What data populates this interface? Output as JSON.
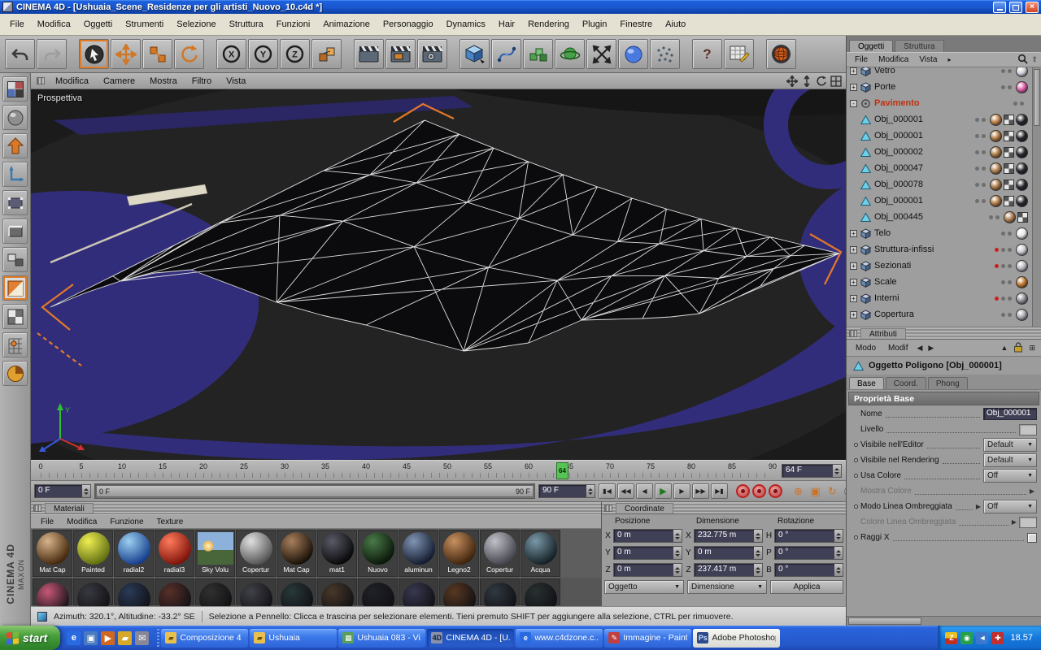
{
  "window": {
    "title": "CINEMA 4D - [Ushuaia_Scene_Residenze per gli artisti_Nuovo_10.c4d *]"
  },
  "menubar": [
    "File",
    "Modifica",
    "Oggetti",
    "Strumenti",
    "Selezione",
    "Struttura",
    "Funzioni",
    "Animazione",
    "Personaggio",
    "Dynamics",
    "Hair",
    "Rendering",
    "Plugin",
    "Finestre",
    "Aiuto"
  ],
  "toolbar": [
    {
      "name": "undo",
      "group": 1
    },
    {
      "name": "redo",
      "group": 1
    },
    {
      "name": "live-selection",
      "group": 2,
      "selected": true
    },
    {
      "name": "move",
      "group": 2
    },
    {
      "name": "scale",
      "group": 2
    },
    {
      "name": "rotate",
      "group": 2
    },
    {
      "name": "lock-x",
      "group": 3
    },
    {
      "name": "lock-y",
      "group": 3
    },
    {
      "name": "lock-z",
      "group": 3
    },
    {
      "name": "coordinate-system",
      "group": 3
    },
    {
      "name": "render-view",
      "group": 4
    },
    {
      "name": "render-active-view",
      "group": 4
    },
    {
      "name": "render-settings",
      "group": 4
    },
    {
      "name": "add-primitive",
      "group": 5
    },
    {
      "name": "add-spline",
      "group": 5
    },
    {
      "name": "add-array",
      "group": 5
    },
    {
      "name": "add-modifier",
      "group": 5
    },
    {
      "name": "add-deformer",
      "group": 5
    },
    {
      "name": "add-environment",
      "group": 5
    },
    {
      "name": "add-particles",
      "group": 5
    },
    {
      "name": "help",
      "group": 6
    },
    {
      "name": "content-browser",
      "group": 6
    },
    {
      "name": "online-updater",
      "group": 7
    }
  ],
  "sidebar": [
    {
      "name": "viewport-layout"
    },
    {
      "name": "model-mode"
    },
    {
      "name": "make-editable"
    },
    {
      "name": "axis-mode"
    },
    {
      "name": "points-mode"
    },
    {
      "name": "edges-mode"
    },
    {
      "name": "polygons-mode"
    },
    {
      "name": "texture-mode",
      "selected": true
    },
    {
      "name": "workplane-mode"
    },
    {
      "name": "snap-mode"
    },
    {
      "name": "render-region"
    }
  ],
  "viewport": {
    "menu": [
      "Modifica",
      "Camere",
      "Mostra",
      "Filtro",
      "Vista"
    ],
    "label": "Prospettiva",
    "nav_icons": [
      "pan-view-icon",
      "dolly-view-icon",
      "rotate-view-icon",
      "toggle-views-icon"
    ]
  },
  "timeline": {
    "tick_labels": [
      "0",
      "5",
      "10",
      "15",
      "20",
      "25",
      "30",
      "35",
      "40",
      "45",
      "50",
      "55",
      "60",
      "65",
      "70",
      "75",
      "80",
      "85",
      "90"
    ],
    "current_marker": "64",
    "current_frame": "64 F",
    "range_start": "0 F",
    "range_min_label": "0 F",
    "range_max_label": "90 F",
    "range_end": "90 F",
    "transport": [
      "goto-start",
      "prev-key",
      "prev-frame",
      "play",
      "next-frame",
      "next-key",
      "goto-end"
    ],
    "records": [
      "record-keyframe-icon",
      "autokey-icon",
      "record-settings-icon"
    ],
    "extras": [
      "record-position-icon",
      "record-scale-icon",
      "record-rotation-icon",
      "record-parameter-icon",
      "keyframe-bar-icon",
      "layout-icon"
    ]
  },
  "materials": {
    "header": "Materiali",
    "menu": [
      "File",
      "Modifica",
      "Funzione",
      "Texture"
    ],
    "items": [
      {
        "label": "Mat Cap",
        "c1": "#d8b48c",
        "c2": "#402408"
      },
      {
        "label": "Painted",
        "c1": "#f0ee52",
        "c2": "#5a6a10"
      },
      {
        "label": "radial2",
        "c1": "#9cd0f0",
        "c2": "#123a8a"
      },
      {
        "label": "radial3",
        "c1": "#ff7a5a",
        "c2": "#7a1008"
      },
      {
        "label": "Sky Volu",
        "type": "sky"
      },
      {
        "label": "Copertur",
        "c1": "#e0e0e0",
        "c2": "#505050"
      },
      {
        "label": "Mat Cap",
        "c1": "#a8805c",
        "c2": "#140c04"
      },
      {
        "label": "mat1",
        "c1": "#5a5a66",
        "c2": "#060608"
      },
      {
        "label": "Nuovo",
        "c1": "#4a7a48",
        "c2": "#081408"
      },
      {
        "label": "aluminun",
        "c1": "#8094b4",
        "c2": "#10182a"
      },
      {
        "label": "Legno2",
        "c1": "#c89060",
        "c2": "#3a200a"
      },
      {
        "label": "Copertur",
        "c1": "#c0c0c8",
        "c2": "#404048"
      },
      {
        "label": "Acqua",
        "c1": "#7a98a8",
        "c2": "#101c20"
      }
    ],
    "partial_row": [
      "#c85878",
      "#383840",
      "#2a3a58",
      "#583028",
      "#303030",
      "#404048",
      "#28383a",
      "#483828",
      "#202028",
      "#383850",
      "#583820",
      "#303840",
      "#283030"
    ]
  },
  "coordinates": {
    "header": "Coordinate",
    "columns": [
      "Posizione",
      "Dimensione",
      "Rotazione"
    ],
    "rows": [
      {
        "p_l": "X",
        "p_v": "0 m",
        "d_l": "X",
        "d_v": "232.775 m",
        "r_l": "H",
        "r_v": "0 °"
      },
      {
        "p_l": "Y",
        "p_v": "0 m",
        "d_l": "Y",
        "d_v": "0 m",
        "r_l": "P",
        "r_v": "0 °"
      },
      {
        "p_l": "Z",
        "p_v": "0 m",
        "d_l": "Z",
        "d_v": "237.417 m",
        "r_l": "B",
        "r_v": "0 °"
      }
    ],
    "mode_left": "Oggetto",
    "mode_mid": "Dimensione",
    "apply": "Applica"
  },
  "object_manager": {
    "tabs": [
      {
        "label": "Oggetti",
        "active": true
      },
      {
        "label": "Struttura",
        "active": false
      }
    ],
    "menu": [
      "File",
      "Modifica",
      "Vista"
    ],
    "tree": [
      {
        "label": "Vetro",
        "level": 0,
        "toggle": "+",
        "icon": "cube",
        "chips": [
          "sphere:#d0d0d8"
        ]
      },
      {
        "label": "Porte",
        "level": 0,
        "toggle": "+",
        "icon": "cube",
        "chips": [
          "sphere:#e060a8"
        ]
      },
      {
        "label": "Pavimento",
        "level": 0,
        "toggle": "-",
        "icon": "null",
        "selected": true,
        "chips": []
      },
      {
        "label": "Obj_000001",
        "level": 1,
        "icon": "polygon",
        "chips": [
          "sphere:#c08048",
          "checker",
          "sphere:#26262e"
        ]
      },
      {
        "label": "Obj_000001",
        "level": 1,
        "icon": "polygon",
        "chips": [
          "sphere:#b07a44",
          "checker",
          "sphere:#26262e"
        ]
      },
      {
        "label": "Obj_000002",
        "level": 1,
        "icon": "polygon",
        "chips": [
          "sphere:#a87840",
          "checker",
          "sphere:#26262e"
        ]
      },
      {
        "label": "Obj_000047",
        "level": 1,
        "icon": "polygon",
        "chips": [
          "sphere:#b08050",
          "checker",
          "sphere:#26262e"
        ]
      },
      {
        "label": "Obj_000078",
        "level": 1,
        "icon": "polygon",
        "chips": [
          "sphere:#a87848",
          "checker",
          "sphere:#26262e"
        ]
      },
      {
        "label": "Obj_000001",
        "level": 1,
        "icon": "polygon",
        "chips": [
          "sphere:#b07a44",
          "checker",
          "sphere:#26262e"
        ]
      },
      {
        "label": "Obj_000445",
        "level": 1,
        "icon": "polygon",
        "chips": [
          "sphere:#b08050",
          "checker"
        ]
      },
      {
        "label": "Telo",
        "level": 0,
        "toggle": "+",
        "icon": "cube",
        "chips": [
          "sphere:#e8e8e8"
        ]
      },
      {
        "label": "Struttura-infissi",
        "level": 0,
        "toggle": "+",
        "icon": "cube",
        "dot": "red",
        "chips": [
          "sphere:#c8c8d0"
        ]
      },
      {
        "label": "Sezionati",
        "level": 0,
        "toggle": "+",
        "icon": "cube",
        "dot": "red",
        "chips": [
          "sphere:#b8b8c0"
        ]
      },
      {
        "label": "Scale",
        "level": 0,
        "toggle": "+",
        "icon": "cube",
        "chips": [
          "sphere:#c07830"
        ]
      },
      {
        "label": "Interni",
        "level": 0,
        "toggle": "+",
        "icon": "cube",
        "dot": "red",
        "chips": [
          "sphere:#909098"
        ]
      },
      {
        "label": "Copertura",
        "level": 0,
        "toggle": "+",
        "icon": "cube",
        "chips": [
          "sphere:#a8a8b0"
        ]
      }
    ]
  },
  "attributes": {
    "header": "Attributi",
    "mode_label": "Modo",
    "modif_label": "Modif",
    "object_title": "Oggetto Poligono [Obj_000001]",
    "tabs": [
      {
        "label": "Base",
        "active": true
      },
      {
        "label": "Coord.",
        "active": false
      },
      {
        "label": "Phong",
        "active": false
      }
    ],
    "section": "Proprietà Base",
    "fields": [
      {
        "label": "Nome",
        "control": "input",
        "value": "Obj_000001"
      },
      {
        "label": "Livello",
        "control": "mini"
      },
      {
        "label": "Visibile nell'Editor",
        "control": "dropdown",
        "value": "Default",
        "dot": true
      },
      {
        "label": "Visibile nel Rendering",
        "control": "dropdown",
        "value": "Default",
        "dot": true
      },
      {
        "label": "Usa Colore",
        "control": "dropdown",
        "value": "Off",
        "dot": true
      },
      {
        "label": "Mostra Colore",
        "control": "none",
        "arrow": true,
        "disabled": true
      },
      {
        "label": "Modo Linea Ombreggiata",
        "control": "dropdown",
        "value": "Off",
        "dot": true,
        "arrow": true
      },
      {
        "label": "Colore Linea Ombreggiata",
        "control": "mini",
        "arrow": true,
        "disabled": true
      },
      {
        "label": "Raggi X",
        "control": "checkbox",
        "dot": true
      }
    ]
  },
  "statusbar": {
    "left": "Azimuth: 320.1°, Altitudine: -33.2°  SE",
    "right": "Selezione a Pennello: Clicca e trascina per selezionare elementi. Tieni premuto SHIFT per aggiungere alla selezione, CTRL per rimuovere."
  },
  "taskbar": {
    "start": "start",
    "quick_launch": [
      "internet-explorer-icon",
      "show-desktop-icon",
      "media-player-icon",
      "folder-icon",
      "mail-icon"
    ],
    "buttons": [
      {
        "label": "Composizione 4",
        "icon": "folder"
      },
      {
        "label": "Ushuaia",
        "icon": "folder"
      },
      {
        "label": "Ushuaia 083 - Vi...",
        "icon": "image"
      },
      {
        "label": "CINEMA 4D - [U...",
        "icon": "c4d",
        "active": true
      },
      {
        "label": "www.c4dzone.c...",
        "icon": "ie"
      },
      {
        "label": "Immagine - Paint",
        "icon": "paint"
      },
      {
        "label": "Adobe Photoshop",
        "icon": "ps",
        "light": true
      }
    ],
    "tray_icons": [
      "zonealarm-icon",
      "messenger-icon",
      "volume-icon",
      "antivirus-icon"
    ],
    "clock": "18.57"
  },
  "brand": {
    "line1": "MAXON",
    "line2": "CINEMA 4D"
  }
}
